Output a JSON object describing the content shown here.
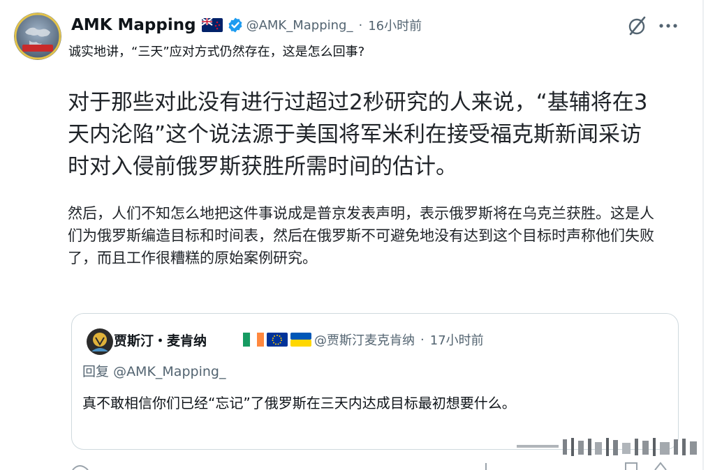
{
  "tweet": {
    "display_name": "AMK Mapping",
    "handle": "@AMK_Mapping_",
    "separator": "·",
    "time": "16小时前",
    "subtitle": "诚实地讲，“三天”应对方式仍然存在，这是怎么回事?",
    "body_large": "对于那些对此没有进行过超过2秒研究的人来说，“基辅将在3天内沦陷”这个说法源于美国将军米利在接受福克斯新闻采访时对入侵前俄罗斯获胜所需时间的估计。",
    "body_medium": "然后，人们不知怎么地把这件事说成是普京发表声明，表示俄罗斯将在乌克兰获胜。这是人们为俄罗斯编造目标和时间表，然后在俄罗斯不可避免地没有达到这个目标时声称他们失败了，而且工作很糟糕的原始案例研究。",
    "avatar_logo_text": "AMK Mapping"
  },
  "quote": {
    "display_name": "贾斯汀・麦肯纳",
    "handle": "@贾斯汀麦克肯纳",
    "separator": "·",
    "time": "17小时前",
    "reply_prefix": "回复",
    "reply_mention": "@AMK_Mapping_",
    "text": "真不敢相信你们已经“忘记”了俄罗斯在三天内达成目标最初想要什么。"
  },
  "icons": {
    "verified": "verified-badge-icon",
    "grok": "grok-slash-icon",
    "more": "more-dots-icon",
    "flags": [
      "new-zealand-flag-icon",
      "ireland-flag-icon",
      "eu-flag-icon",
      "ukraine-flag-icon"
    ]
  },
  "colors": {
    "verified_blue": "#1d9bf0",
    "secondary_text": "#536471",
    "card_border": "#cfd9de"
  }
}
